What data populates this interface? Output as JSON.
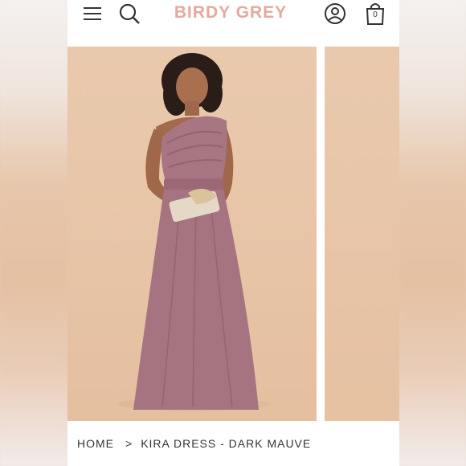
{
  "header": {
    "logo_text": "BIRDY GREY",
    "cart_count": "0",
    "icons": [
      "menu-icon",
      "search-icon",
      "account-icon",
      "shopping-bag-icon"
    ]
  },
  "gallery": {
    "images": [
      "product-photo-main",
      "product-photo-next"
    ]
  },
  "breadcrumb": {
    "home": "HOME",
    "separator": ">",
    "current": "KIRA DRESS - DARK MAUVE"
  },
  "colors": {
    "brand": "#e5a99e",
    "backdrop": "#e8c7aa",
    "dress": "#a67480"
  }
}
